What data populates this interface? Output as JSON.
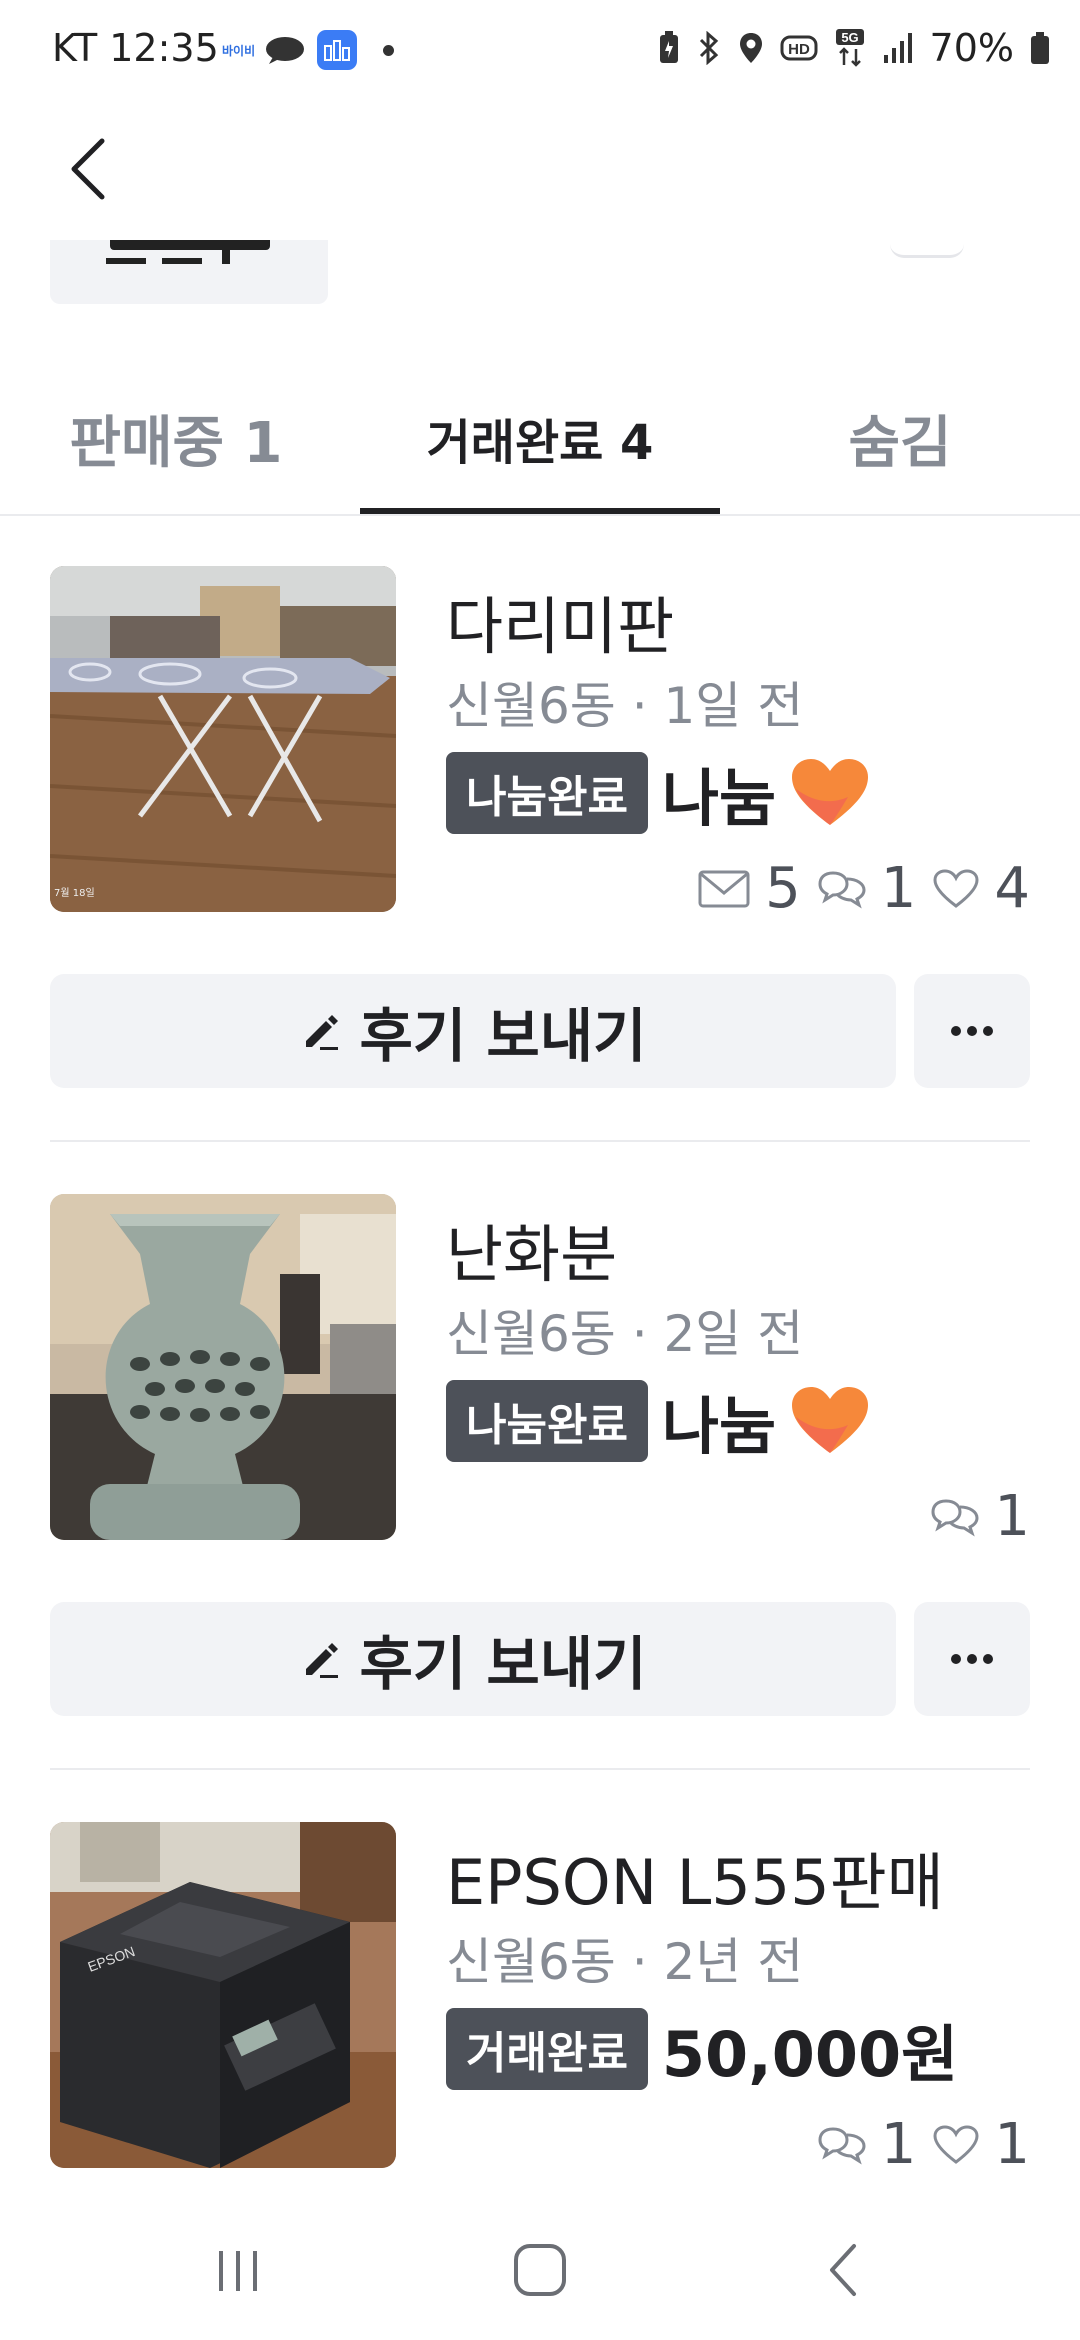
{
  "status_bar": {
    "time": "KT 12:35",
    "app_pill": "바이비",
    "battery": "70%"
  },
  "tabs": [
    {
      "label": "판매중 1"
    },
    {
      "label": "거래완료 4"
    },
    {
      "label": "숨김"
    }
  ],
  "items": [
    {
      "title": "다리미판",
      "meta": "신월6동 · 1일 전",
      "status": "나눔완료",
      "price": "나눔",
      "chats": "5",
      "comments": "1",
      "likes": "4",
      "review_label": "후기 보내기"
    },
    {
      "title": "난화분",
      "meta": "신월6동 · 2일 전",
      "status": "나눔완료",
      "price": "나눔",
      "comments": "1",
      "review_label": "후기 보내기"
    },
    {
      "title": "EPSON L555판매",
      "meta": "신월6동 · 2년 전",
      "status": "거래완료",
      "price": "50,000원",
      "comments": "1",
      "likes": "1"
    }
  ],
  "colors": {
    "badge_bg": "#4d5159",
    "tab_active": "#212124",
    "tab_inactive": "#868b94",
    "button_bg": "#f2f3f6"
  },
  "icons": [
    "back-arrow-icon",
    "pencil-icon",
    "more-dots-icon",
    "mail-icon",
    "chat-bubble-icon",
    "heart-outline-icon",
    "orange-heart-emoji-icon",
    "nav-recents-icon",
    "nav-home-icon",
    "nav-back-icon"
  ]
}
